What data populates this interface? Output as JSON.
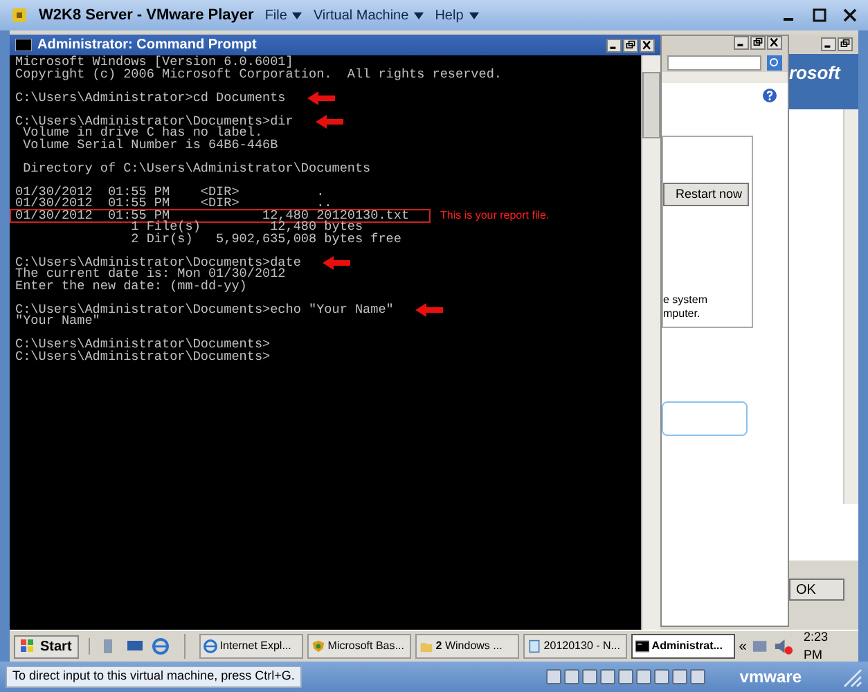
{
  "player": {
    "title": "W2K8 Server - VMware Player",
    "menus": [
      "File",
      "Virtual Machine",
      "Help"
    ]
  },
  "console": {
    "title": "Administrator: Command Prompt",
    "note": "This is your report file.",
    "blocks": [
      [
        {
          "text": "Microsoft Windows [Version 6.0.6001]",
          "arrow": false,
          "boxed": false
        },
        {
          "text": "Copyright (c) 2006 Microsoft Corporation.  All rights reserved.",
          "arrow": false,
          "boxed": false
        }
      ],
      [
        {
          "text": "C:\\Users\\Administrator>cd Documents",
          "arrow": true,
          "boxed": false
        }
      ],
      [
        {
          "text": "C:\\Users\\Administrator\\Documents>dir",
          "arrow": true,
          "boxed": false
        },
        {
          "text": " Volume in drive C has no label.",
          "arrow": false,
          "boxed": false
        },
        {
          "text": " Volume Serial Number is 64B6-446B",
          "arrow": false,
          "boxed": false
        }
      ],
      [
        {
          "text": " Directory of C:\\Users\\Administrator\\Documents",
          "arrow": false,
          "boxed": false
        }
      ],
      [
        {
          "text": "01/30/2012  01:55 PM    <DIR>          .",
          "arrow": false,
          "boxed": false
        },
        {
          "text": "01/30/2012  01:55 PM    <DIR>          ..",
          "arrow": false,
          "boxed": false
        },
        {
          "text": "01/30/2012  01:55 PM            12,480 20120130.txt",
          "arrow": false,
          "boxed": true
        },
        {
          "text": "               1 File(s)         12,480 bytes",
          "arrow": false,
          "boxed": false
        },
        {
          "text": "               2 Dir(s)   5,902,635,008 bytes free",
          "arrow": false,
          "boxed": false
        }
      ],
      [
        {
          "text": "C:\\Users\\Administrator\\Documents>date",
          "arrow": true,
          "boxed": false
        },
        {
          "text": "The current date is: Mon 01/30/2012",
          "arrow": false,
          "boxed": false
        },
        {
          "text": "Enter the new date: (mm-dd-yy)",
          "arrow": false,
          "boxed": false
        }
      ],
      [
        {
          "text": "C:\\Users\\Administrator\\Documents>echo \"Your Name\"",
          "arrow": true,
          "boxed": false
        },
        {
          "text": "\"Your Name\"",
          "arrow": false,
          "boxed": false
        }
      ],
      [
        {
          "text": "C:\\Users\\Administrator\\Documents>",
          "arrow": false,
          "boxed": false
        },
        {
          "text": "C:\\Users\\Administrator\\Documents>",
          "arrow": false,
          "boxed": false
        }
      ]
    ]
  },
  "dialog": {
    "button": "Restart now",
    "text_lines": [
      "e system",
      "mputer."
    ]
  },
  "browser": {
    "logo": "rosoft",
    "button": "OK"
  },
  "taskbar": {
    "start": "Start",
    "tasks": [
      {
        "label": "Internet Expl...",
        "kind": "browser",
        "selected": false
      },
      {
        "label": "Microsoft Bas...",
        "kind": "security",
        "selected": false
      },
      {
        "label": "**2** Windows ...",
        "kind": "folder",
        "selected": false
      },
      {
        "label": "20120130 - N...",
        "kind": "editor",
        "selected": false
      },
      {
        "label": "Administrat...",
        "kind": "console",
        "selected": true
      }
    ],
    "chevron": "«",
    "clock": "2:23 PM"
  },
  "status_bar": {
    "hint": "To direct input to this virtual machine, press Ctrl+G.",
    "logo": "vmware"
  }
}
